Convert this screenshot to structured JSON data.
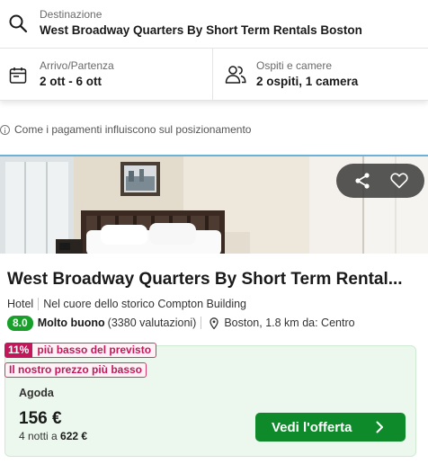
{
  "search": {
    "destination_label": "Destinazione",
    "destination_value": "West Broadway Quarters By Short Term Rentals Boston",
    "dates_label": "Arrivo/Partenza",
    "dates_value": "2 ott - 6 ott",
    "guests_label": "Ospiti e camere",
    "guests_value": "2 ospiti, 1 camera"
  },
  "info_text": "Come i pagamenti influiscono sul posizionamento",
  "hotel": {
    "name": "West Broadway Quarters By Short Term Rental...",
    "type": "Hotel",
    "tagline": "Nel cuore dello storico Compton Building",
    "rating_score": "8.0",
    "rating_word": "Molto buono",
    "rating_count": "(3380 valutazioni)",
    "location": "Boston, 1.8 km da: Centro"
  },
  "offer": {
    "discount_percent": "11%",
    "discount_text": "più basso del previsto",
    "best_price_tag": "Il nostro prezzo più basso",
    "provider": "Agoda",
    "price": "156 €",
    "nights_prefix": "4 notti a",
    "total": "622 €",
    "cta_label": "Vedi l'offerta"
  },
  "icons": {
    "search": "search-icon",
    "calendar": "calendar-icon",
    "guests": "people-icon",
    "info": "info-icon",
    "share": "share-icon",
    "favorite": "heart-icon",
    "location": "pin-icon",
    "cta": "chevron-right-icon"
  },
  "colors": {
    "rating_green": "#18a02b",
    "cta_green": "#0f8a2b",
    "offer_background": "#ecf8ee",
    "deal_pink": "#c2185b"
  }
}
